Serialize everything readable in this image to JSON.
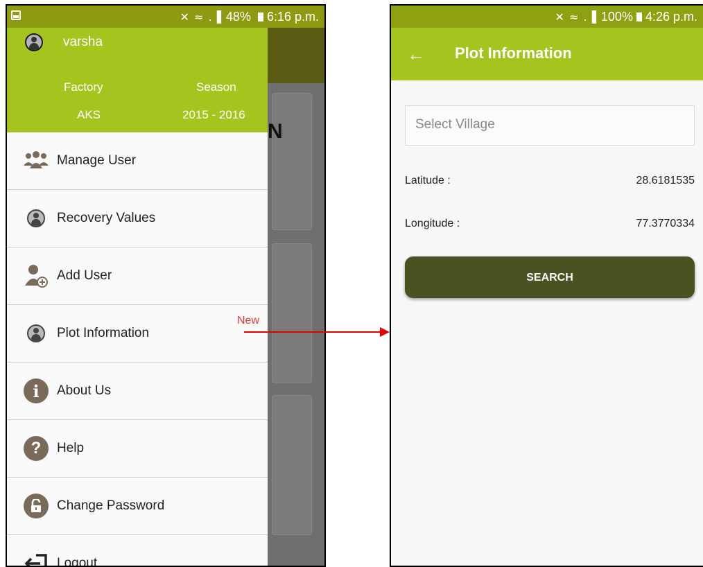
{
  "left_screen": {
    "status": {
      "icons": "✕ ≈ .▐",
      "battery": "48%",
      "time": "6:16 p.m."
    },
    "drawer": {
      "username": "varsha",
      "factory_label": "Factory",
      "season_label": "Season",
      "factory_value": "AKS",
      "season_value": "2015 - 2016",
      "items": [
        {
          "label": "Manage User",
          "icon": "manage-users-icon"
        },
        {
          "label": "Recovery Values",
          "icon": "user-circle-icon"
        },
        {
          "label": "Add User",
          "icon": "add-user-icon"
        },
        {
          "label": "Plot Information",
          "icon": "user-circle-icon",
          "badge": "New"
        },
        {
          "label": "About Us",
          "icon": "info-icon"
        },
        {
          "label": "Help",
          "icon": "help-icon"
        },
        {
          "label": "Change Password",
          "icon": "lock-icon"
        },
        {
          "label": "Logout",
          "icon": "logout-icon"
        }
      ]
    },
    "background_letter": "N"
  },
  "right_screen": {
    "status": {
      "icons": "✕ ≈ .▐",
      "battery": "100%",
      "time": "4:26 p.m."
    },
    "toolbar": {
      "title": "Plot Information"
    },
    "village_select": {
      "placeholder": "Select Village"
    },
    "latitude": {
      "label": "Latitude :",
      "value": "28.6181535"
    },
    "longitude": {
      "label": "Longitude :",
      "value": "77.3770334"
    },
    "search_button": "SEARCH"
  },
  "colors": {
    "accent": "#a4c41e",
    "button": "#4a5222",
    "badge": "#e53935",
    "arrow": "#e00000"
  }
}
